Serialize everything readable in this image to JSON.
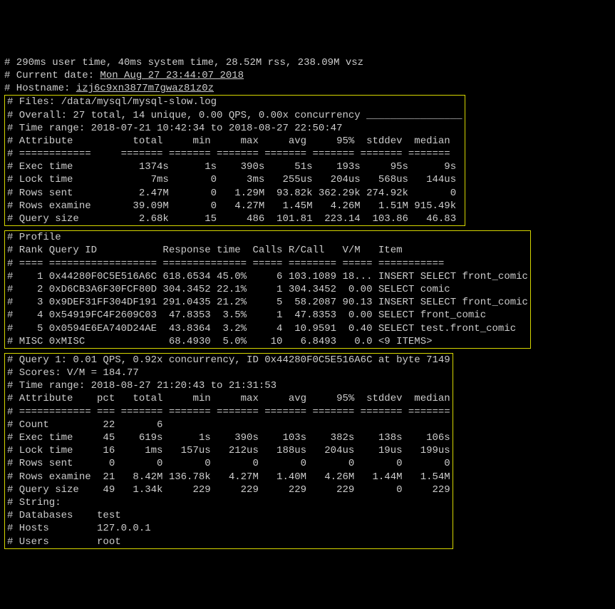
{
  "header": {
    "perf": "# 290ms user time, 40ms system time, 28.52M rss, 238.09M vsz",
    "date_lbl": "# Current date: ",
    "date_val": "Mon Aug 27 23:44:07 2018",
    "host_lbl": "# Hostname: ",
    "host_val": "izj6c9xn3877m7gwaz81z0z"
  },
  "box1": {
    "l1": "# Files: /data/mysql/mysql-slow.log",
    "l2": "# Overall: 27 total, 14 unique, 0.00 QPS, 0.00x concurrency ________________",
    "l3": "# Time range: 2018-07-21 10:42:34 to 2018-08-27 22:50:47",
    "l4": "# Attribute          total     min     max     avg     95%  stddev  median",
    "l5": "# ============     ======= ======= ======= ======= ======= ======= =======",
    "l6": "# Exec time           1374s      1s    390s     51s    193s     95s      9s",
    "l7": "# Lock time             7ms       0     3ms   255us   204us   568us   144us",
    "l8": "# Rows sent           2.47M       0   1.29M  93.82k 362.29k 274.92k       0",
    "l9": "# Rows examine       39.09M       0   4.27M   1.45M   4.26M   1.51M 915.49k",
    "l10": "# Query size          2.68k      15     486  101.81  223.14  103.86   46.83"
  },
  "box2": {
    "l1": "# Profile",
    "l2": "# Rank Query ID           Response time  Calls R/Call   V/M   Item",
    "l3": "# ==== ================== ============== ===== ======== ===== ===========",
    "l4": "#    1 0x44280F0C5E516A6C 618.6534 45.0%     6 103.1089 18... INSERT SELECT front_comic",
    "l5": "#    2 0xD6CB3A6F30FCF80D 304.3452 22.1%     1 304.3452  0.00 SELECT comic",
    "l6": "#    3 0x9DEF31FF304DF191 291.0435 21.2%     5  58.2087 90.13 INSERT SELECT front_comic",
    "l7": "#    4 0x54919FC4F2609C03  47.8353  3.5%     1  47.8353  0.00 SELECT front_comic",
    "l8": "#    5 0x0594E6EA740D24AE  43.8364  3.2%     4  10.9591  0.40 SELECT test.front_comic",
    "l9": "# MISC 0xMISC              68.4930  5.0%    10   6.8493   0.0 <9 ITEMS>"
  },
  "box3": {
    "l1": "# Query 1: 0.01 QPS, 0.92x concurrency, ID 0x44280F0C5E516A6C at byte 7149",
    "l2": "# Scores: V/M = 184.77",
    "l3": "# Time range: 2018-08-27 21:20:43 to 21:31:53",
    "l4": "# Attribute    pct   total     min     max     avg     95%  stddev  median",
    "l5": "# ============ === ======= ======= ======= ======= ======= ======= =======",
    "l6": "# Count         22       6",
    "l7": "# Exec time     45    619s      1s    390s    103s    382s    138s    106s",
    "l8": "# Lock time     16     1ms   157us   212us   188us   204us    19us   199us",
    "l9": "# Rows sent      0       0       0       0       0       0       0       0",
    "l10": "# Rows examine  21   8.42M 136.78k   4.27M   1.40M   4.26M   1.44M   1.54M",
    "l11": "# Query size    49   1.34k     229     229     229     229       0     229",
    "l12": "# String:",
    "l13": "# Databases    test",
    "l14": "# Hosts        127.0.0.1",
    "l15": "# Users        root"
  }
}
